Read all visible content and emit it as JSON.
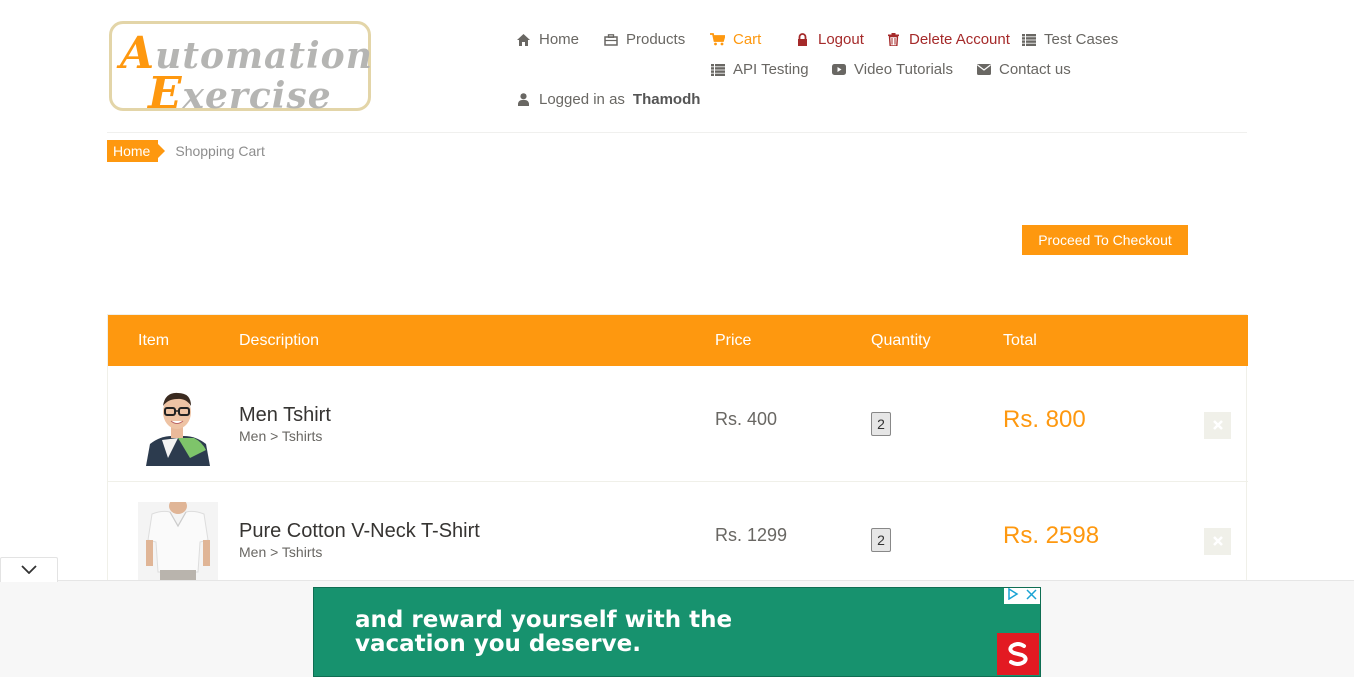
{
  "logo": {
    "line1_cap": "A",
    "line1_rest": "utomation",
    "line2_cap": "E",
    "line2_rest": "xercise"
  },
  "nav": {
    "home": "Home",
    "products": "Products",
    "cart": "Cart",
    "logout": "Logout",
    "delete_account": "Delete Account",
    "test_cases": "Test Cases",
    "api_testing": "API Testing",
    "video_tutorials": "Video Tutorials",
    "contact_us": "Contact us",
    "logged_in_prefix": "Logged in as",
    "username": "Thamodh"
  },
  "breadcrumb": {
    "home": "Home",
    "current": "Shopping Cart"
  },
  "checkout": {
    "label": "Proceed To Checkout"
  },
  "cart": {
    "headers": {
      "item": "Item",
      "description": "Description",
      "price": "Price",
      "quantity": "Quantity",
      "total": "Total"
    },
    "rows": [
      {
        "name": "Men Tshirt",
        "category": "Men > Tshirts",
        "price": "Rs. 400",
        "quantity": "2",
        "total": "Rs. 800"
      },
      {
        "name": "Pure Cotton V-Neck T-Shirt",
        "category": "Men > Tshirts",
        "price": "Rs. 1299",
        "quantity": "2",
        "total": "Rs. 2598"
      }
    ]
  },
  "ad": {
    "line1": "and reward yourself with the",
    "line2": "vacation you deserve."
  },
  "colors": {
    "accent": "#FE980F",
    "danger": "#a52a2a",
    "ad_green": "#17926e",
    "ad_red": "#e31a22"
  }
}
